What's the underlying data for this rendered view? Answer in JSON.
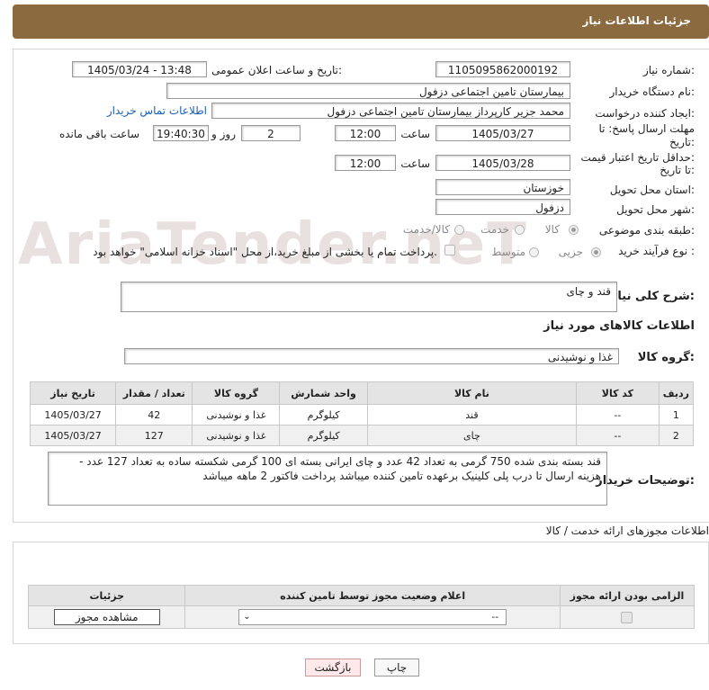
{
  "header": {
    "title": "جزئیات اطلاعات نیاز"
  },
  "watermark": "AriaTender.neT",
  "form": {
    "need_number_label": "شماره نیاز:",
    "need_number": "1105095862000192",
    "announce_label": "تاریخ و ساعت اعلان عمومی:",
    "announce_value": "1405/03/24 - 13:48",
    "buyer_org_label": "نام دستگاه خریدار:",
    "buyer_org": "بیمارستان تامین اجتماعی دزفول",
    "creator_label": "ایجاد کننده درخواست:",
    "creator": "محمد جزیر کارپرداز بیمارستان تامین اجتماعی دزفول",
    "contact_link": "اطلاعات تماس خریدار",
    "deadline_label_1": "مهلت ارسال پاسخ: تا",
    "deadline_label_2": "تاریخ:",
    "deadline_date": "1405/03/27",
    "time_label": "ساعت",
    "deadline_time": "12:00",
    "days_value": "2",
    "days_label": "روز و",
    "remaining_time": "19:40:30",
    "remaining_label": "ساعت باقی مانده",
    "validity_label_1": "حداقل تاریخ اعتبار قیمت:",
    "validity_label_2": "تا تاریخ:",
    "validity_date": "1405/03/28",
    "validity_time": "12:00",
    "province_label": "استان محل تحویل:",
    "province": "خوزستان",
    "city_label": "شهر محل تحویل:",
    "city": "دزفول",
    "category_label": "طبقه بندی موضوعی:",
    "category_options": [
      "کالا",
      "خدمت",
      "کالا/خدمت"
    ],
    "process_label": "نوع فرآیند خرید :",
    "process_options": [
      "جزیی",
      "متوسط"
    ],
    "payment_note": "پرداخت تمام یا بخشی از مبلغ خرید،از محل \"اسناد خزانه اسلامی\" خواهد بود.",
    "summary_label": "شرح کلی نیاز:",
    "summary": "قند و چای",
    "goods_info_title": "اطلاعات کالاهای مورد نیاز",
    "goods_group_label": "گروه کالا:",
    "goods_group": "غذا و نوشیدنی"
  },
  "items_table": {
    "headers": [
      "ردیف",
      "کد کالا",
      "نام کالا",
      "واحد شمارش",
      "گروه کالا",
      "تعداد / مقدار",
      "تاریخ نیاز"
    ],
    "rows": [
      [
        "1",
        "--",
        "قند",
        "کیلوگرم",
        "غذا و نوشیدنی",
        "42",
        "1405/03/27"
      ],
      [
        "2",
        "--",
        "چای",
        "کیلوگرم",
        "غذا و نوشیدنی",
        "127",
        "1405/03/27"
      ]
    ]
  },
  "buyer_notes_label": "توضیحات خریدار:",
  "buyer_notes": "قند بسته بندی شده 750 گرمی به تعداد 42 عدد و چای ایرانی بسته ای 100 گرمی شکسته ساده به تعداد 127 عدد - هزینه ارسال تا درب پلی کلینیک برعهده تامین کننده میباشد پرداخت فاکتور 2 ماهه میباشد",
  "permits": {
    "section_title": "اطلاعات مجوزهای ارائه خدمت / کالا",
    "headers": [
      "الزامی بودن ارائه مجوز",
      "اعلام وضعیت مجوز توسط تامین کننده",
      "جزئیات"
    ],
    "select_value": "--",
    "view_button": "مشاهده مجوز"
  },
  "footer": {
    "print_button": "چاپ",
    "back_button": "بازگشت"
  }
}
